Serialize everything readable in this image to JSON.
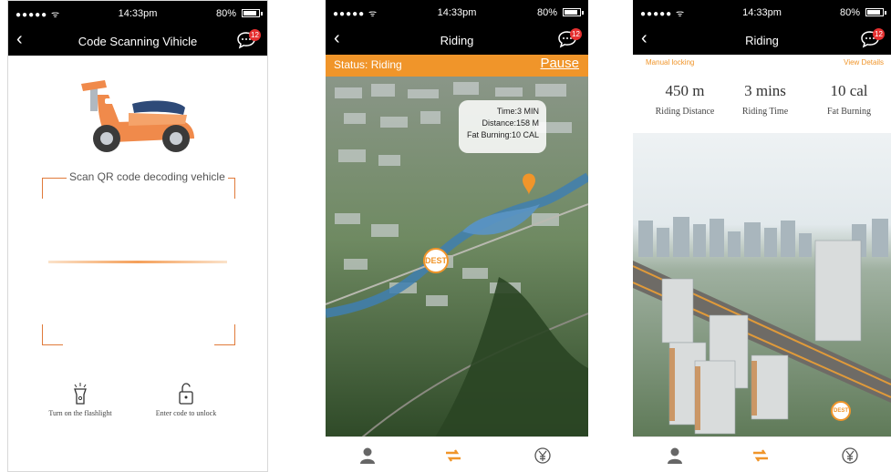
{
  "status_bar": {
    "signal": "●●●●● ᯤ",
    "time": "14:33pm",
    "battery": "80%"
  },
  "screen1": {
    "title": "Code Scanning Vihicle",
    "badge": "12",
    "scan_label": "Scan QR code decoding vehicle",
    "flashlight_label": "Turn on the flashlight",
    "code_label": "Enter code to unlock"
  },
  "screen2": {
    "title": "Riding",
    "badge": "12",
    "status": "Status: Riding",
    "pause_label": "Pause",
    "bubble": {
      "time": "Time:3 MIN",
      "distance": "Distance:158 M",
      "fat": "Fat Burning:10 CAL"
    },
    "dest_label": "DEST"
  },
  "screen3": {
    "title": "Riding",
    "badge": "12",
    "manual_locking": "Manual locking",
    "view_details": "View Details",
    "stats": [
      {
        "value": "450 m",
        "label": "Riding Distance"
      },
      {
        "value": "3 mins",
        "label": "Riding Time"
      },
      {
        "value": "10 cal",
        "label": "Fat Burning"
      }
    ],
    "dest_label": "DEST"
  },
  "colors": {
    "accent": "#f0952a",
    "scooter": "#f08a4b",
    "bar": "#000000"
  },
  "icons": [
    "back-icon",
    "chat-icon",
    "scooter-icon",
    "flashlight-icon",
    "unlock-icon",
    "user-icon",
    "ride-icon",
    "yen-icon"
  ]
}
